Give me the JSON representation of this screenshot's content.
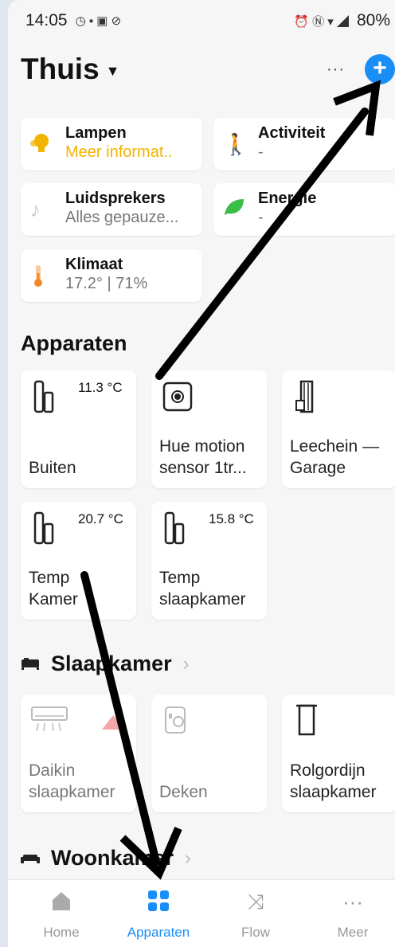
{
  "status": {
    "time": "14:05",
    "battery": "80%"
  },
  "header": {
    "title": "Thuis",
    "more": "···",
    "add": "+"
  },
  "categories": [
    {
      "title": "Lampen",
      "subtitle": "Meer informat..",
      "icon": "bulb-icon"
    },
    {
      "title": "Activiteit",
      "subtitle": "-",
      "icon": "walking-person-icon"
    },
    {
      "title": "Luidsprekers",
      "subtitle": "Alles gepauze...",
      "icon": "music-note-icon"
    },
    {
      "title": "Energie",
      "subtitle": "-",
      "icon": "leaf-icon"
    },
    {
      "title": "Klimaat",
      "subtitle": "17.2° | 71%",
      "icon": "thermometer-icon"
    }
  ],
  "devices_section": {
    "title": "Apparaten"
  },
  "devices": [
    {
      "name1": "Buiten",
      "name2": "",
      "value": "11.3 °C",
      "icon": "door-sensor-icon"
    },
    {
      "name1": "Hue motion",
      "name2": "sensor 1tr...",
      "value": "",
      "icon": "motion-sensor-icon"
    },
    {
      "name1": "Leechein —",
      "name2": "Garage",
      "value": "",
      "icon": "garage-door-icon"
    },
    {
      "name1": "Temp",
      "name2": "Kamer",
      "value": "20.7 °C",
      "icon": "door-sensor-icon"
    },
    {
      "name1": "Temp",
      "name2": "slaapkamer",
      "value": "15.8 °C",
      "icon": "door-sensor-icon"
    }
  ],
  "rooms": [
    {
      "name": "Slaapkamer",
      "icon": "bed-icon"
    },
    {
      "name": "Woonkamer",
      "icon": "sofa-icon"
    }
  ],
  "room_devices": [
    {
      "name1": "Daikin",
      "name2": "slaapkamer",
      "icon": "air-conditioner-icon"
    },
    {
      "name1": "Deken",
      "name2": "",
      "icon": "smart-plug-icon"
    },
    {
      "name1": "Rolgordijn",
      "name2": "slaapkamer",
      "icon": "blind-icon"
    }
  ],
  "tabs": [
    {
      "label": "Home",
      "icon": "home-icon",
      "active": false
    },
    {
      "label": "Apparaten",
      "icon": "grid-icon",
      "active": true
    },
    {
      "label": "Flow",
      "icon": "shuffle-icon",
      "active": false
    },
    {
      "label": "Meer",
      "icon": "more-dots-icon",
      "active": false
    }
  ],
  "colors": {
    "accent": "#1a8ef7",
    "lamp_yellow": "#f1b400",
    "leaf_green": "#3bbd4a",
    "activity_blue": "#1a8ef7",
    "warning_red": "#e0404a"
  }
}
